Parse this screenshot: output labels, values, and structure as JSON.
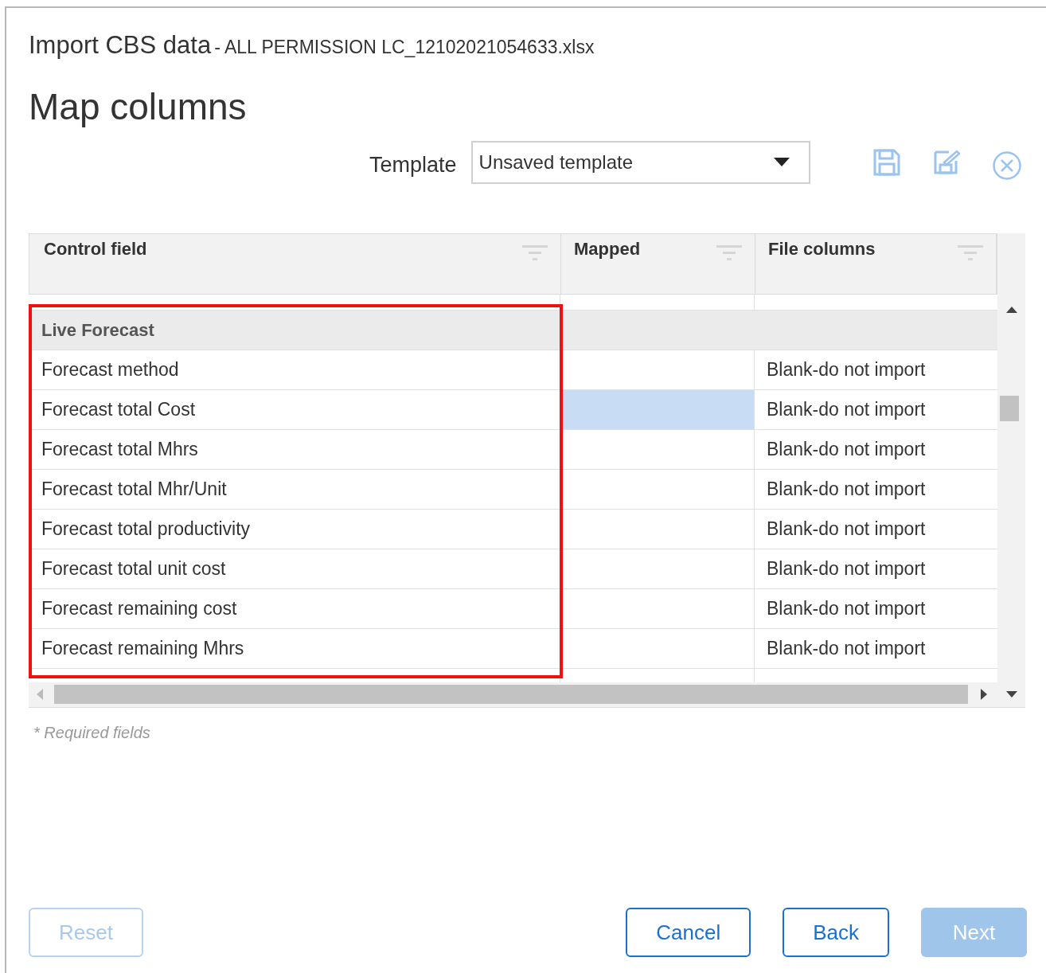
{
  "dialog": {
    "title": "Import CBS data",
    "file_name": "- ALL PERMISSION LC_12102021054633.xlsx",
    "heading": "Map columns"
  },
  "template": {
    "label": "Template",
    "value": "Unsaved template"
  },
  "table": {
    "columns": [
      {
        "label": "Control field"
      },
      {
        "label": "Mapped"
      },
      {
        "label": "File columns"
      }
    ],
    "group": "Live Forecast",
    "rows": [
      {
        "control_field": "Forecast method",
        "selected": false,
        "file_column": "Blank-do not import"
      },
      {
        "control_field": "Forecast total Cost",
        "selected": true,
        "file_column": "Blank-do not import"
      },
      {
        "control_field": "Forecast total Mhrs",
        "selected": false,
        "file_column": "Blank-do not import"
      },
      {
        "control_field": "Forecast total Mhr/Unit",
        "selected": false,
        "file_column": "Blank-do not import"
      },
      {
        "control_field": "Forecast total productivity",
        "selected": false,
        "file_column": "Blank-do not import"
      },
      {
        "control_field": "Forecast total unit cost",
        "selected": false,
        "file_column": "Blank-do not import"
      },
      {
        "control_field": "Forecast remaining cost",
        "selected": false,
        "file_column": "Blank-do not import"
      },
      {
        "control_field": "Forecast remaining Mhrs",
        "selected": false,
        "file_column": "Blank-do not import"
      }
    ]
  },
  "footnote": "* Required fields",
  "buttons": [
    {
      "label": "Reset",
      "kind": "outline",
      "disabled": true
    },
    {
      "label": "Cancel",
      "kind": "outline",
      "disabled": false
    },
    {
      "label": "Back",
      "kind": "outline",
      "disabled": false
    },
    {
      "label": "Next",
      "kind": "primary",
      "disabled": true
    }
  ]
}
